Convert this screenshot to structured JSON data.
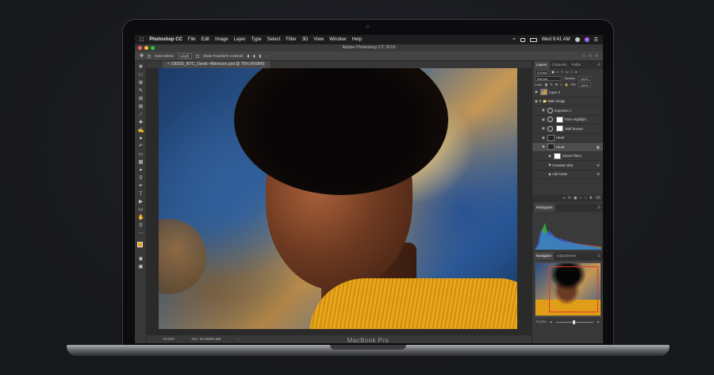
{
  "device": {
    "label": "MacBook Pro"
  },
  "menubar": {
    "apple_icon": "apple-icon",
    "app_name": "Photoshop CC",
    "menus": [
      "File",
      "Edit",
      "Image",
      "Layer",
      "Type",
      "Select",
      "Filter",
      "3D",
      "View",
      "Window",
      "Help"
    ],
    "clock": "Wed 9:41 AM"
  },
  "window": {
    "title": "Adobe Photoshop CC 2019"
  },
  "options_bar": {
    "auto_select_label": "Auto-Select:",
    "auto_select_value": "Layer",
    "show_transform_label": "Show Transform Controls"
  },
  "document": {
    "tab_title": "190325_NYC_Derek--Afternoon.psd @ 70% (RGB/8)",
    "zoom": "70.63%",
    "doc_size": "Doc: 54.9M/94.6M"
  },
  "panels": {
    "layers_tabs": [
      "Layers",
      "Channels",
      "Paths"
    ],
    "kind_label": "Kind",
    "blend_mode": "Normal",
    "opacity_label": "Opacity:",
    "opacity_value": "100%",
    "lock_label": "Lock:",
    "fill_label": "Fill:",
    "fill_value": "100%",
    "layers": [
      {
        "name": "Layer 0",
        "thumb": "photo",
        "selected": false
      },
      {
        "name": "Main Image",
        "thumb": "folder",
        "selected": false
      },
      {
        "name": "Exposure 1",
        "thumb": "adj",
        "selected": false
      },
      {
        "name": "Face Highlight",
        "thumb": "white",
        "selected": false
      },
      {
        "name": "Wall Texture",
        "thumb": "white",
        "selected": false
      },
      {
        "name": "Head",
        "thumb": "dark",
        "selected": false
      },
      {
        "name": "Head",
        "thumb": "dark",
        "selected": true
      },
      {
        "name": "Smart Filters",
        "thumb": "white",
        "selected": false
      },
      {
        "name": "Gaussian Blur",
        "thumb": "none",
        "selected": false
      },
      {
        "name": "Add Noise",
        "thumb": "none",
        "selected": false
      }
    ],
    "histogram_tab": "Histogram",
    "navigator_tabs": [
      "Navigator",
      "Adjustments"
    ],
    "navigator_zoom": "70.63%"
  },
  "colors": {
    "foreground": "#e8a61a",
    "background": "#ffffff",
    "nav_frame": "#e23a2a"
  }
}
